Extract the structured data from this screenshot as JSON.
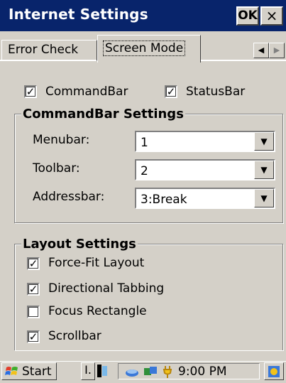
{
  "window": {
    "title": "Internet Settings",
    "ok_label": "OK",
    "close_label": "×"
  },
  "tabs": [
    {
      "label": "Error Check",
      "active": false
    },
    {
      "label": "Screen Mode",
      "active": true
    }
  ],
  "top_checks": [
    {
      "label": "CommandBar",
      "checked": true
    },
    {
      "label": "StatusBar",
      "checked": true
    }
  ],
  "commandbar_group": {
    "title": "CommandBar Settings",
    "rows": [
      {
        "label": "Menubar:",
        "value": "1"
      },
      {
        "label": "Toolbar:",
        "value": "2"
      },
      {
        "label": "Addressbar:",
        "value": "3:Break"
      }
    ]
  },
  "layout_group": {
    "title": "Layout Settings",
    "items": [
      {
        "label": "Force-Fit Layout",
        "checked": true
      },
      {
        "label": "Directional Tabbing",
        "checked": true
      },
      {
        "label": "Focus Rectangle",
        "checked": false
      },
      {
        "label": "Scrollbar",
        "checked": true
      }
    ]
  },
  "taskbar": {
    "start_label": "Start",
    "task_label": "I.",
    "time": "9:00 PM"
  },
  "colors": {
    "titlebar": "#08246b",
    "face": "#d4d0c8"
  }
}
